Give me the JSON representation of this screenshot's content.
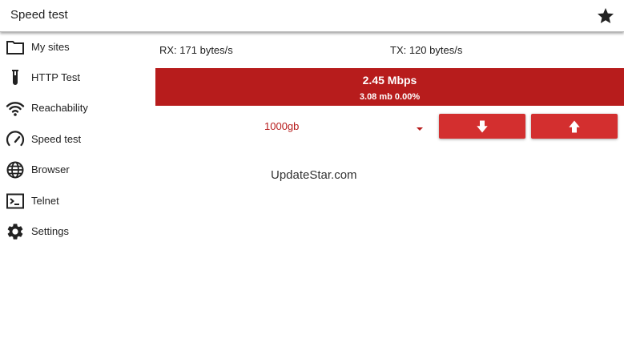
{
  "app": {
    "title": "Speed test",
    "favorite_icon": "star-icon"
  },
  "sidebar": {
    "items": [
      {
        "label": "My sites",
        "icon": "folder-icon"
      },
      {
        "label": "HTTP Test",
        "icon": "test-tube-icon"
      },
      {
        "label": "Reachability",
        "icon": "wifi-icon"
      },
      {
        "label": "Speed test",
        "icon": "speedometer-icon"
      },
      {
        "label": "Browser",
        "icon": "globe-icon"
      },
      {
        "label": "Telnet",
        "icon": "terminal-icon"
      },
      {
        "label": "Settings",
        "icon": "gear-icon"
      }
    ]
  },
  "stats": {
    "rx": "RX: 171 bytes/s",
    "tx": "TX: 120 bytes/s"
  },
  "result": {
    "speed": "2.45 Mbps",
    "detail": "3.08 mb 0.00%"
  },
  "size_select": {
    "value": "1000gb",
    "arrow_icon": "dropdown-arrow-icon"
  },
  "actions": {
    "download_icon": "arrow-down-icon",
    "upload_icon": "arrow-up-icon"
  },
  "watermark": "UpdateStar.com",
  "colors": {
    "accent": "#b71c1c",
    "button": "#d32f2f",
    "banner": "#b71c1c"
  }
}
